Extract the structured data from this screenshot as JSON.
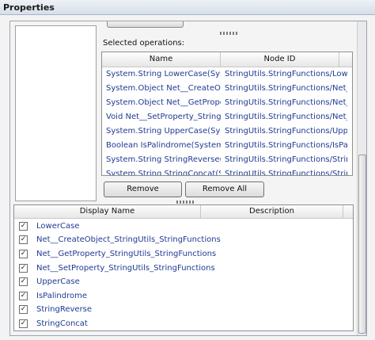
{
  "window": {
    "title": "Properties"
  },
  "operations": {
    "section_label": "Selected operations:",
    "columns": [
      "Name",
      "Node ID"
    ],
    "rows": [
      [
        "System.String LowerCase(Syster",
        "StringUtils.StringFunctions/Lowe"
      ],
      [
        "System.Object Net__CreateObje",
        "StringUtils.StringFunctions/Net_"
      ],
      [
        "System.Object Net__GetProperty",
        "StringUtils.StringFunctions/Net_"
      ],
      [
        "Void Net__SetProperty_StringUti",
        "StringUtils.StringFunctions/Net_"
      ],
      [
        "System.String UpperCase(Syster",
        "StringUtils.StringFunctions/Uppe"
      ],
      [
        "Boolean IsPalindrome(System.S",
        "StringUtils.StringFunctions/IsPal"
      ],
      [
        "System.String StringReverse(Sys",
        "StringUtils.StringFunctions/Strin"
      ],
      [
        "System.String StringConcat(Syst",
        "StringUtils.StringFunctions/Strin"
      ]
    ],
    "remove_label": "Remove",
    "remove_all_label": "Remove All"
  },
  "display": {
    "columns": [
      "Display Name",
      "Description"
    ],
    "items": [
      {
        "label": "LowerCase",
        "checked": true
      },
      {
        "label": "Net__CreateObject_StringUtils_StringFunctions",
        "checked": true
      },
      {
        "label": "Net__GetProperty_StringUtils_StringFunctions",
        "checked": true
      },
      {
        "label": "Net__SetProperty_StringUtils_StringFunctions",
        "checked": true
      },
      {
        "label": "UpperCase",
        "checked": true
      },
      {
        "label": "IsPalindrome",
        "checked": true
      },
      {
        "label": "StringReverse",
        "checked": true
      },
      {
        "label": "StringConcat",
        "checked": true
      }
    ]
  }
}
